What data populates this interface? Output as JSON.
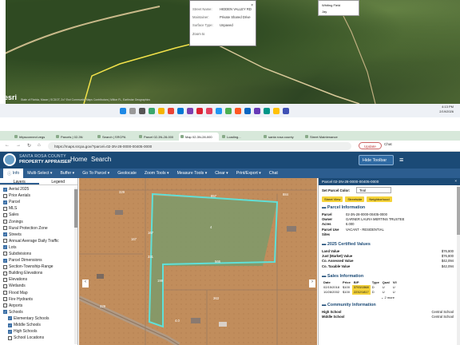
{
  "top_screenshot": {
    "popup": {
      "street_label": "Street Name:",
      "street_value": "HIDDEN VALLEY RD",
      "maintainer_label": "Maintainer:",
      "maintainer_value": "Private Shared Drive",
      "surface_label": "Surface Type:",
      "surface_value": "Unpaved",
      "zoom_label": "Zoom to"
    },
    "legend_items": [
      "Whiting Field",
      "Jay"
    ],
    "esri_logo": "esri",
    "attribution": "State of Florida, Maxar | SCDOT, 2x? Esri Community Maps Contributors | Milton FL, Earthstar Geographics",
    "clock": {
      "time": "4:13 PM",
      "date": "2/19/2026"
    }
  },
  "browser": {
    "tabs": [
      {
        "label": "httpsconnect.vegs"
      },
      {
        "label": "Parcels | 02-3N"
      },
      {
        "label": "Search | SRCPA"
      },
      {
        "label": "Parcel 02-3N-28-000"
      },
      {
        "label": "Map 02-3N-28-000"
      },
      {
        "label": "Loading..."
      },
      {
        "label": "santa rosa county"
      },
      {
        "label": "Street Maintenance"
      }
    ],
    "url": "https://maps.srcpa.gov/?parcel=02-3N-28-0000-00405-0000",
    "update_label": "Update",
    "chat_label": "Chat"
  },
  "app": {
    "brand_line1": "SANTA ROSA COUNTY",
    "brand_line2": "PROPERTY APPRAISER",
    "home": "Home",
    "search": "Search",
    "hide_toolbar": "Hide Toolbar",
    "toolbar": [
      "Info",
      "Multi-Select ▾",
      "Buffer ▾",
      "Go To Parcel ▾",
      "Geolocate",
      "Zoom Tools ▾",
      "Measure Tools ▾",
      "Clear ▾",
      "Print/Export ▾",
      "Chat"
    ]
  },
  "layers_panel": {
    "tabs": [
      "Layers",
      "Legend"
    ],
    "items": [
      {
        "label": "Aerial 2025",
        "checked": true,
        "indent": 0
      },
      {
        "label": "Prior Aerials",
        "checked": false,
        "indent": 0
      },
      {
        "label": "Parcel",
        "checked": true,
        "indent": 0
      },
      {
        "label": "MLS",
        "checked": false,
        "indent": 0
      },
      {
        "label": "Sales",
        "checked": false,
        "indent": 0
      },
      {
        "label": "Zonings",
        "checked": false,
        "indent": 0
      },
      {
        "label": "Rural Protection Zone",
        "checked": false,
        "indent": 0
      },
      {
        "label": "Streets",
        "checked": true,
        "indent": 0
      },
      {
        "label": "Annual Average Daily Traffic",
        "checked": false,
        "indent": 0
      },
      {
        "label": "Lots",
        "checked": true,
        "indent": 0
      },
      {
        "label": "Subdivisions",
        "checked": false,
        "indent": 0
      },
      {
        "label": "Parcel Dimensions",
        "checked": true,
        "indent": 0
      },
      {
        "label": "Section-Township-Range",
        "checked": false,
        "indent": 0
      },
      {
        "label": "Building Elevations",
        "checked": false,
        "indent": 0
      },
      {
        "label": "Elevations",
        "checked": false,
        "indent": 0
      },
      {
        "label": "Wetlands",
        "checked": false,
        "indent": 0
      },
      {
        "label": "Flood Map",
        "checked": false,
        "indent": 0
      },
      {
        "label": "Fire Hydrants",
        "checked": false,
        "indent": 0
      },
      {
        "label": "Airports",
        "checked": false,
        "indent": 0
      },
      {
        "label": "Schools",
        "checked": true,
        "indent": 0
      },
      {
        "label": "Elementary Schools",
        "checked": true,
        "indent": 1
      },
      {
        "label": "Middle Schools",
        "checked": true,
        "indent": 1
      },
      {
        "label": "High Schools",
        "checked": true,
        "indent": 1
      },
      {
        "label": "School Locations",
        "checked": false,
        "indent": 1
      }
    ]
  },
  "map": {
    "dimension_labels": [
      "329",
      "857",
      "884",
      "167",
      "167",
      "331",
      "566",
      "199",
      "363",
      "329",
      "4",
      "4.0"
    ],
    "parcel_color": "#5fe0d8"
  },
  "parcel_panel": {
    "header": "Parcel 02-3N-28-0000-00405-0000",
    "set_color_label": "Set Parcel Color:",
    "set_color_value": "Teal",
    "buttons": [
      "Street View",
      "Streetside",
      "Neighborhood"
    ],
    "info_title": "Parcel Information",
    "info": [
      {
        "k": "Parcel",
        "v": "02-3N-28-0000-00405-0000"
      },
      {
        "k": "Owner",
        "v": "GARNER LAURA MERTINS TRUSTEE"
      },
      {
        "k": "Acres",
        "v": "6.000"
      },
      {
        "k": "Parcel Use",
        "v": "VACANT - RESIDENTIAL"
      },
      {
        "k": "Sites",
        "v": ""
      }
    ],
    "values_title": "2025 Certified Values",
    "values": [
      {
        "k": "Land Value",
        "v": "$76,800"
      },
      {
        "k": "Just (Market) Value",
        "v": "$76,800"
      },
      {
        "k": "Co. Assessed Value",
        "v": "$42,094"
      },
      {
        "k": "Co. Taxable Value",
        "v": "$42,094"
      }
    ],
    "sales_title": "Sales Information",
    "sales_headers": [
      "Date",
      "Price",
      "B/P",
      "Type",
      "Qual",
      "V/I"
    ],
    "sales_rows": [
      [
        "02/15/2018",
        "$100",
        "3793/1568",
        "D",
        "U",
        "U"
      ],
      [
        "10/28/2002",
        "$100",
        "2232/1817",
        "D",
        "U",
        "U"
      ]
    ],
    "sales_more": "2 more",
    "community_title": "Community Information",
    "community": [
      {
        "k": "High School",
        "v": "Central School"
      },
      {
        "k": "Middle School",
        "v": "Central School"
      }
    ]
  }
}
